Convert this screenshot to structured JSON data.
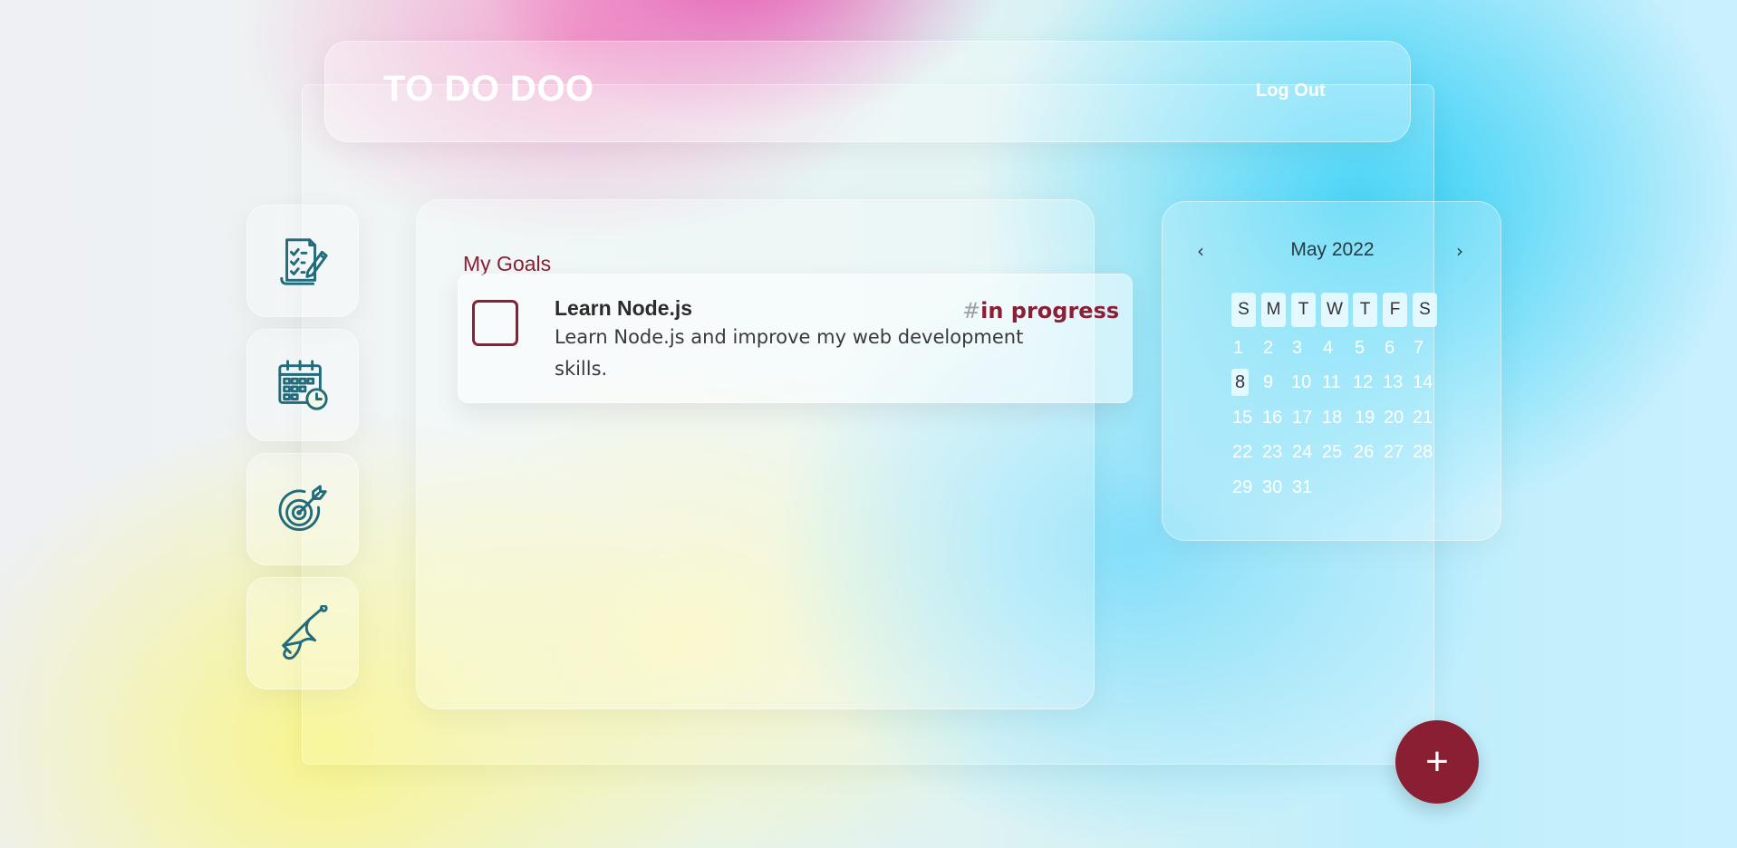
{
  "header": {
    "title": "TO DO DOO",
    "logout_label": "Log Out"
  },
  "sidebar": {
    "items": [
      {
        "icon": "checklist-icon"
      },
      {
        "icon": "calendar-clock-icon"
      },
      {
        "icon": "target-icon"
      },
      {
        "icon": "bell-icon"
      }
    ]
  },
  "goals": {
    "title": "My Goals",
    "items": [
      {
        "title": "Learn Node.js",
        "description": "Learn Node.js and improve my web development skills.",
        "tag_prefix": "#",
        "tag": "in progress",
        "checked": false
      }
    ]
  },
  "calendar": {
    "prev": "‹",
    "next": "›",
    "month_label": "May 2022",
    "weekdays": [
      "S",
      "M",
      "T",
      "W",
      "T",
      "F",
      "S"
    ],
    "selected_day": "8",
    "weeks": [
      [
        "1",
        "2",
        "3",
        "4",
        "5",
        "6",
        "7"
      ],
      [
        "8",
        "9",
        "10",
        "11",
        "12",
        "13",
        "14"
      ],
      [
        "15",
        "16",
        "17",
        "18",
        "19",
        "20",
        "21"
      ],
      [
        "22",
        "23",
        "24",
        "25",
        "26",
        "27",
        "28"
      ],
      [
        "29",
        "30",
        "31"
      ]
    ]
  },
  "fab": {
    "label": "+"
  },
  "colors": {
    "accent": "#8a1f33",
    "icon": "#216b7a"
  }
}
